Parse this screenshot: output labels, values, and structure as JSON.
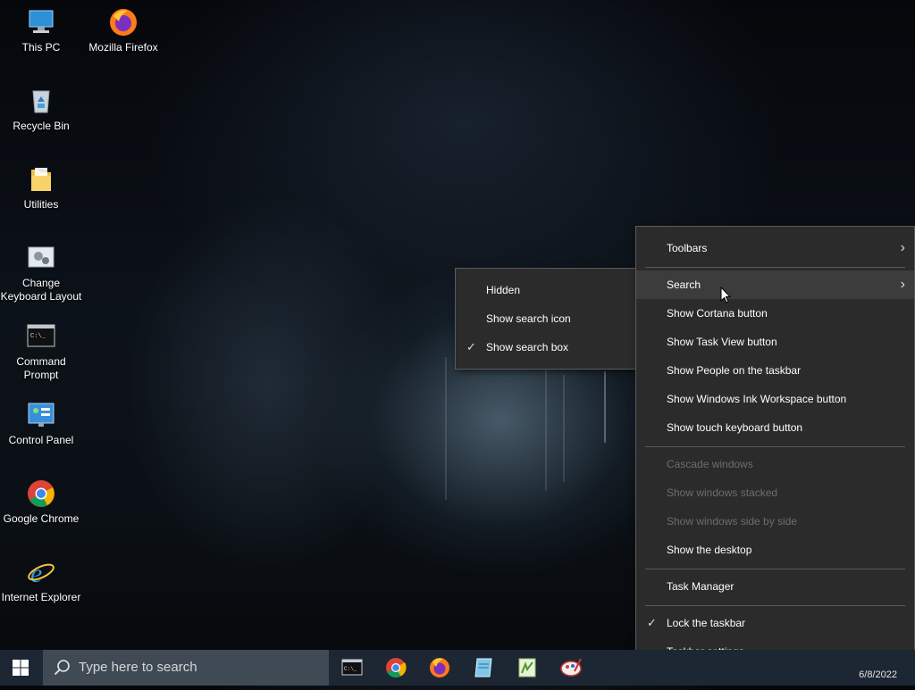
{
  "desktop": {
    "icons": [
      {
        "label": "This PC",
        "icon": "this-pc-icon"
      },
      {
        "label": "Mozilla Firefox",
        "icon": "firefox-icon"
      },
      {
        "label": "Recycle Bin",
        "icon": "recycle-bin-icon"
      },
      {
        "label": "Utilities",
        "icon": "folder-icon"
      },
      {
        "label": "Change Keyboard Layout",
        "icon": "keyboard-layout-icon"
      },
      {
        "label": "Command Prompt",
        "icon": "command-prompt-icon"
      },
      {
        "label": "Control Panel",
        "icon": "control-panel-icon"
      },
      {
        "label": "Google Chrome",
        "icon": "chrome-icon"
      },
      {
        "label": "Internet Explorer",
        "icon": "internet-explorer-icon"
      }
    ]
  },
  "taskbar_menu": {
    "toolbars": "Toolbars",
    "search": "Search",
    "show_cortana": "Show Cortana button",
    "show_task_view": "Show Task View button",
    "show_people": "Show People on the taskbar",
    "show_ink": "Show Windows Ink Workspace button",
    "show_touch_keyboard": "Show touch keyboard button",
    "cascade": "Cascade windows",
    "stacked": "Show windows stacked",
    "side_by_side": "Show windows side by side",
    "show_desktop": "Show the desktop",
    "task_manager": "Task Manager",
    "lock_taskbar": "Lock the taskbar",
    "taskbar_settings": "Taskbar settings",
    "chevron": "›",
    "check": "✓"
  },
  "search_submenu": {
    "hidden": "Hidden",
    "show_icon": "Show search icon",
    "show_box": "Show search box",
    "check": "✓"
  },
  "taskbar": {
    "search_placeholder": "Type here to search",
    "apps": [
      "command-prompt-icon",
      "chrome-icon",
      "firefox-icon",
      "notepad-icon",
      "notepad-plus-icon",
      "paint-icon"
    ],
    "clock_date": "6/8/2022"
  },
  "colors": {
    "menu_bg": "#2b2b2b",
    "menu_highlight": "#3c3c3c",
    "taskbar_bg": "#1c2733",
    "searchbox_bg": "#3f4a55"
  }
}
